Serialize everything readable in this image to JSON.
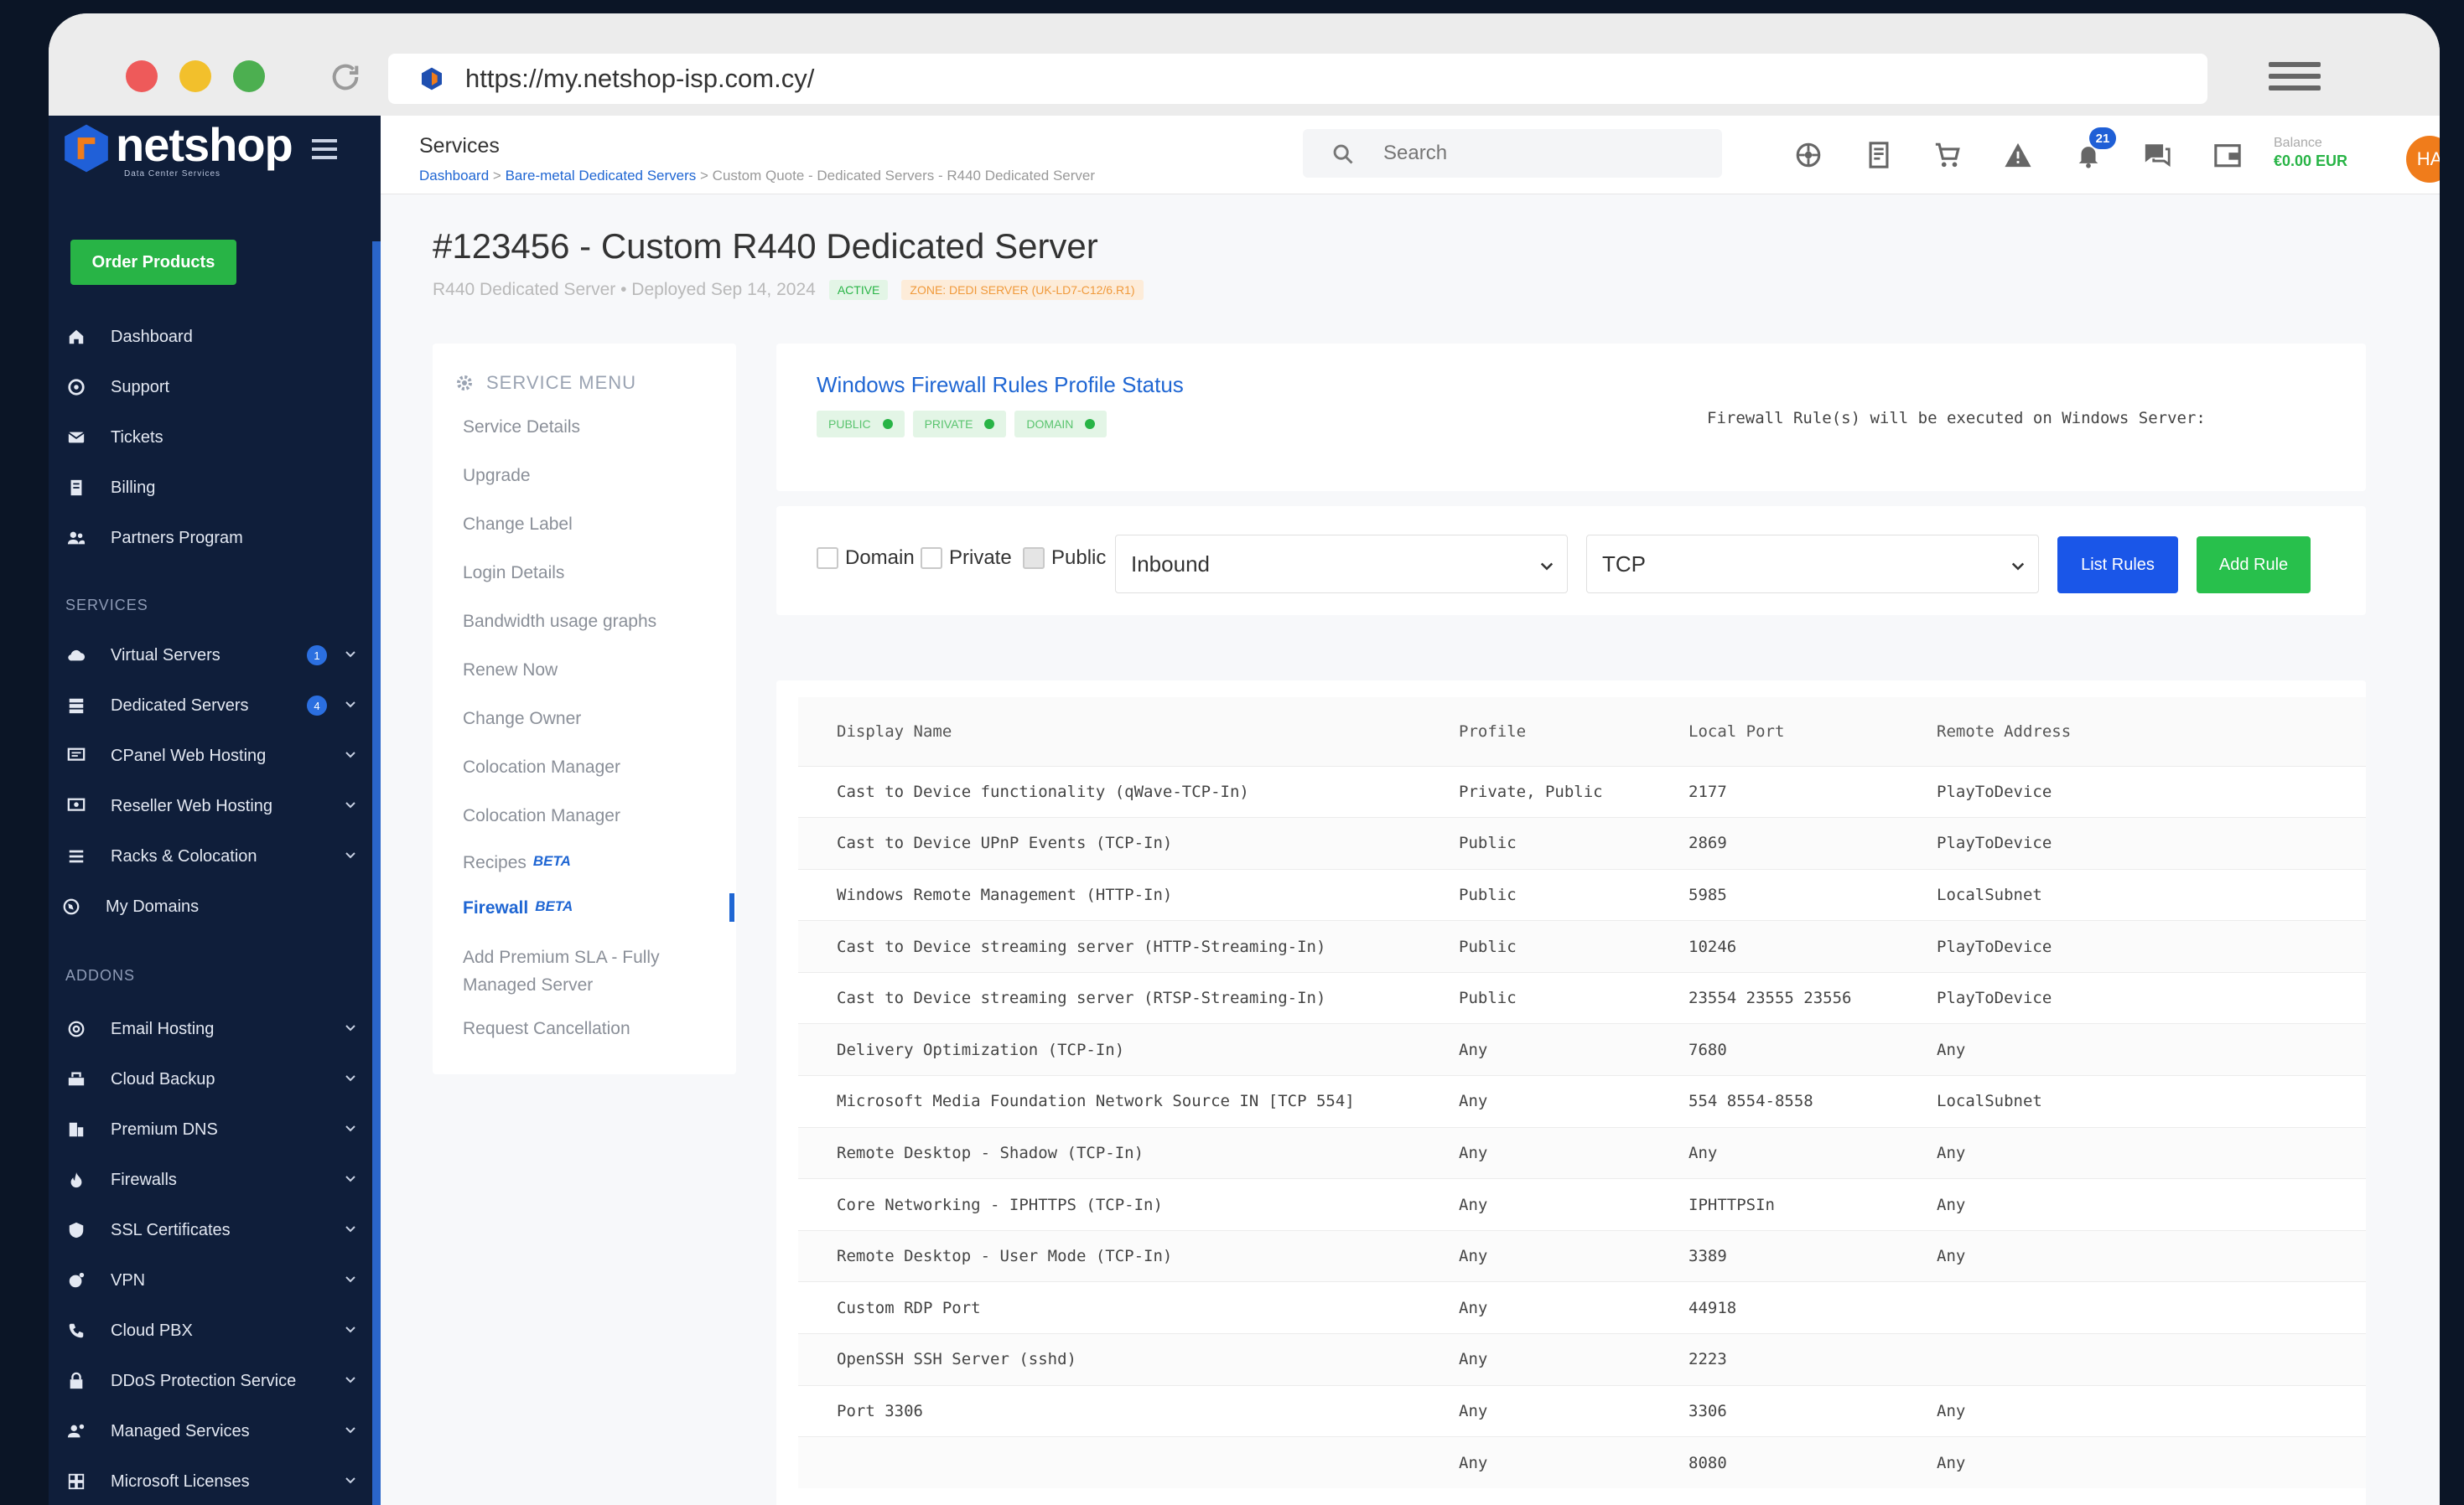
{
  "browser": {
    "url": "https://my.netshop-isp.com.cy/"
  },
  "sidebar": {
    "brand": "netshop",
    "brand_sub": "Data Center Services",
    "order_button": "Order Products",
    "main_items": [
      {
        "label": "Dashboard",
        "icon": "home-icon"
      },
      {
        "label": "Support",
        "icon": "lifebuoy-icon"
      },
      {
        "label": "Tickets",
        "icon": "envelope-icon"
      },
      {
        "label": "Billing",
        "icon": "receipt-icon"
      },
      {
        "label": "Partners Program",
        "icon": "users-icon"
      }
    ],
    "services_heading": "SERVICES",
    "service_items": [
      {
        "label": "Virtual Servers",
        "badge": "1"
      },
      {
        "label": "Dedicated Servers",
        "badge": "4"
      },
      {
        "label": "CPanel Web Hosting"
      },
      {
        "label": "Reseller Web Hosting"
      },
      {
        "label": "Racks & Colocation"
      },
      {
        "label": "My Domains"
      }
    ],
    "addons_heading": "ADDONS",
    "addon_items": [
      {
        "label": "Email Hosting"
      },
      {
        "label": "Cloud Backup"
      },
      {
        "label": "Premium DNS"
      },
      {
        "label": "Firewalls"
      },
      {
        "label": "SSL Certificates"
      },
      {
        "label": "VPN"
      },
      {
        "label": "Cloud PBX"
      },
      {
        "label": "DDoS Protection Service"
      },
      {
        "label": "Managed Services"
      },
      {
        "label": "Microsoft Licenses"
      }
    ]
  },
  "topbar": {
    "title": "Services",
    "crumb1": "Dashboard",
    "crumb2": "Bare-metal Dedicated Servers",
    "crumb3": "Custom Quote - Dedicated Servers - R440 Dedicated Server",
    "search_placeholder": "Search",
    "notifications_count": "21",
    "balance_label": "Balance",
    "balance_value": "€0.00 EUR",
    "avatar_initials": "HA"
  },
  "page": {
    "title": "#123456 - Custom R440 Dedicated Server",
    "meta": "R440 Dedicated Server • Deployed Sep 14, 2024",
    "status": "ACTIVE",
    "zone": "ZONE: DEDI SERVER (UK-LD7-C12/6.R1)"
  },
  "service_menu": {
    "heading": "SERVICE MENU",
    "items": [
      "Service Details",
      "Upgrade",
      "Change Label",
      "Login Details",
      "Bandwidth usage graphs",
      "Renew Now",
      "Change Owner",
      "Colocation Manager",
      "Colocation Manager",
      "Recipes",
      "Firewall",
      "Add Premium SLA - Fully",
      "Managed Server",
      "Request Cancellation"
    ],
    "beta": "BETA"
  },
  "firewall_status": {
    "title": "Windows Firewall Rules Profile Status",
    "tags": [
      "PUBLIC",
      "PRIVATE",
      "DOMAIN"
    ],
    "note": "Firewall Rule(s) will be executed on Windows Server:"
  },
  "filters": {
    "domain_label": "Domain",
    "private_label": "Private",
    "public_label": "Public",
    "direction": "Inbound",
    "protocol": "TCP",
    "list_button": "List Rules",
    "add_button": "Add Rule"
  },
  "rules_table": {
    "headers": [
      "Display Name",
      "Profile",
      "Local Port",
      "Remote Address"
    ],
    "rows": [
      [
        "Cast to Device functionality (qWave-TCP-In)",
        "Private, Public",
        "2177",
        "PlayToDevice"
      ],
      [
        "Cast to Device UPnP Events (TCP-In)",
        "Public",
        "2869",
        "PlayToDevice"
      ],
      [
        "Windows Remote Management (HTTP-In)",
        "Public",
        "5985",
        "LocalSubnet"
      ],
      [
        "Cast to Device streaming server (HTTP-Streaming-In)",
        "Public",
        "10246",
        "PlayToDevice"
      ],
      [
        "Cast to Device streaming server (RTSP-Streaming-In)",
        "Public",
        "23554 23555 23556",
        "PlayToDevice"
      ],
      [
        "Delivery Optimization (TCP-In)",
        "Any",
        "7680",
        "Any"
      ],
      [
        "Microsoft Media Foundation Network Source IN [TCP 554]",
        "Any",
        "554 8554-8558",
        "LocalSubnet"
      ],
      [
        "Remote Desktop - Shadow (TCP-In)",
        "Any",
        "Any",
        "Any"
      ],
      [
        "Core Networking - IPHTTPS (TCP-In)",
        "Any",
        "IPHTTPSIn",
        "Any"
      ],
      [
        "Remote Desktop - User Mode (TCP-In)",
        "Any",
        "3389",
        "Any"
      ],
      [
        "Custom RDP Port",
        "Any",
        "44918",
        ""
      ],
      [
        "OpenSSH SSH Server (sshd)",
        "Any",
        "2223",
        ""
      ],
      [
        "Port 3306",
        "Any",
        "3306",
        "Any"
      ],
      [
        "",
        "Any",
        "8080",
        "Any"
      ]
    ]
  },
  "colors": {
    "sidebar_bg": "#0f1e3a",
    "accent_blue": "#1f66d3",
    "accent_green": "#28b446",
    "avatar_orange": "#f07c1b"
  }
}
